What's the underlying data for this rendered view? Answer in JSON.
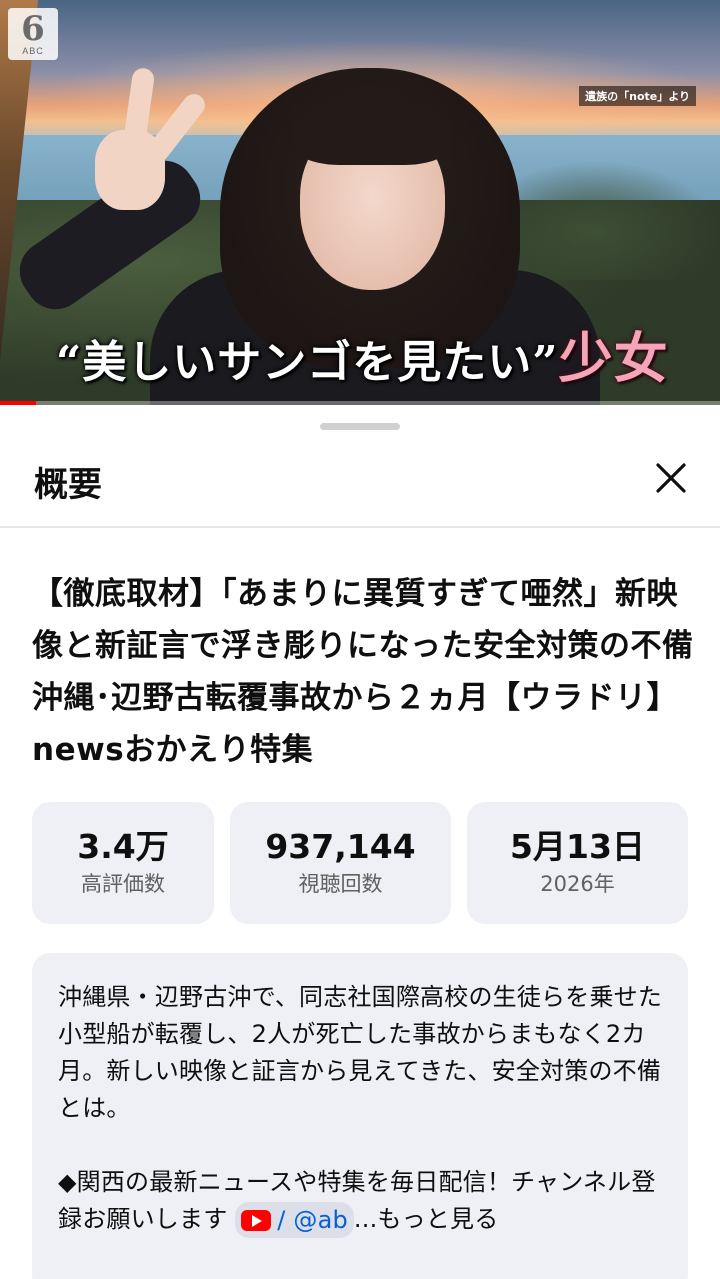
{
  "video": {
    "channel_logo": {
      "number": "6",
      "text": "ABC"
    },
    "source_tag": "遺族の「note」より",
    "caption_main": "“美しいサンゴを見たい”",
    "caption_accent": "少女",
    "progress_fraction": 0.05
  },
  "sheet": {
    "title": "概要",
    "close_icon": "close-icon"
  },
  "video_info": {
    "title": "【徹底取材】「あまりに異質すぎて唖然」新映像と新証言で浮き彫りになった安全対策の不備　沖縄･辺野古転覆事故から２ヵ月【ウラドリ】newsおかえり特集",
    "stats": [
      {
        "value": "3.4万",
        "label": "高評価数"
      },
      {
        "value": "937,144",
        "label": "視聴回数"
      },
      {
        "value": "5月13日",
        "label": "2026年"
      }
    ],
    "description": {
      "paragraph1": "沖縄県・辺野古沖で、同志社国際高校の生徒らを乗せた小型船が転覆し、2人が死亡した事故からまもなく2カ月。新しい映像と証言から見えてきた、安全対策の不備とは。",
      "paragraph2_text": "◆関西の最新ニュースや特集を毎日配信！チャンネル登録お願いします",
      "link_chip": "/ @ab",
      "ellipsis": "...",
      "more_label": "もっと見る"
    }
  },
  "colors": {
    "accent_red": "#ff0000",
    "link_blue": "#065fd4",
    "card_bg": "#eef0f6"
  }
}
